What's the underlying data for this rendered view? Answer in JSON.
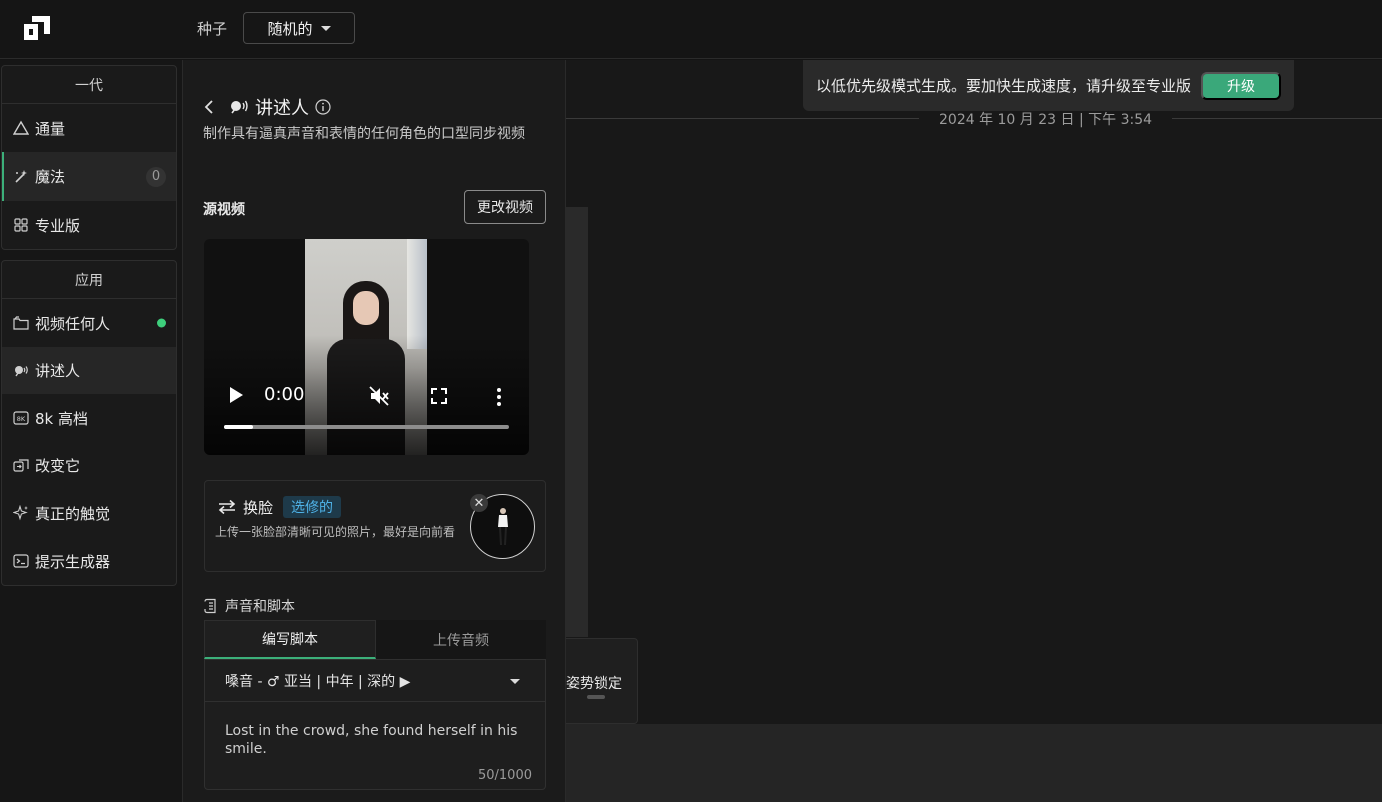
{
  "topbar": {
    "seed_label": "种子",
    "seed_value": "随机的"
  },
  "sidebar": {
    "group1": {
      "header": "一代",
      "items": [
        {
          "label": "通量",
          "icon": "triangle-icon"
        },
        {
          "label": "魔法",
          "icon": "magic-wand-icon",
          "count": "0",
          "active": true
        },
        {
          "label": "专业版",
          "icon": "grid-icon"
        }
      ]
    },
    "group2": {
      "header": "应用",
      "items": [
        {
          "label": "视频任何人",
          "icon": "folder-video-icon",
          "status_dot_color": "#3ecf7c"
        },
        {
          "label": "讲述人",
          "icon": "speaker-person-icon",
          "active": true
        },
        {
          "label": "8k 高档",
          "icon": "8k-icon"
        },
        {
          "label": "改变它",
          "icon": "swap-square-icon"
        },
        {
          "label": "真正的触觉",
          "icon": "sparkle-icon"
        },
        {
          "label": "提示生成器",
          "icon": "terminal-icon"
        }
      ]
    }
  },
  "panel": {
    "title": "讲述人",
    "description": "制作具有逼真声音和表情的任何角色的口型同步视频",
    "source_video_label": "源视频",
    "change_video_button": "更改视频",
    "video": {
      "time": "0:00",
      "progress": 0.1
    },
    "face_swap": {
      "title": "换脸",
      "tag": "选修的",
      "description": "上传一张脸部清晰可见的照片，最好是向前看",
      "remove_symbol": "✕"
    },
    "voice_script_label": "声音和脚本",
    "tabs": [
      {
        "label": "编写脚本",
        "active": true
      },
      {
        "label": "上传音频",
        "active": false
      }
    ],
    "voice_selection": "嗓音 - ♂ 亚当 | 中年 | 深的 ▶",
    "script_text": "Lost in the crowd, she found herself in his smile.",
    "char_count": "50/1000"
  },
  "main": {
    "toast_text": "以低优先级模式生成。要加快生成速度，请升级至专业版",
    "upgrade_button": "升级",
    "date": "2024 年 10 月 23 日 | 下午 3:54",
    "pose_lock_label": "姿势锁定"
  },
  "colors": {
    "accent_green": "#3aa87a",
    "optional_tag_blue": "#4fb3e8",
    "status_dot": "#3ecf7c"
  }
}
